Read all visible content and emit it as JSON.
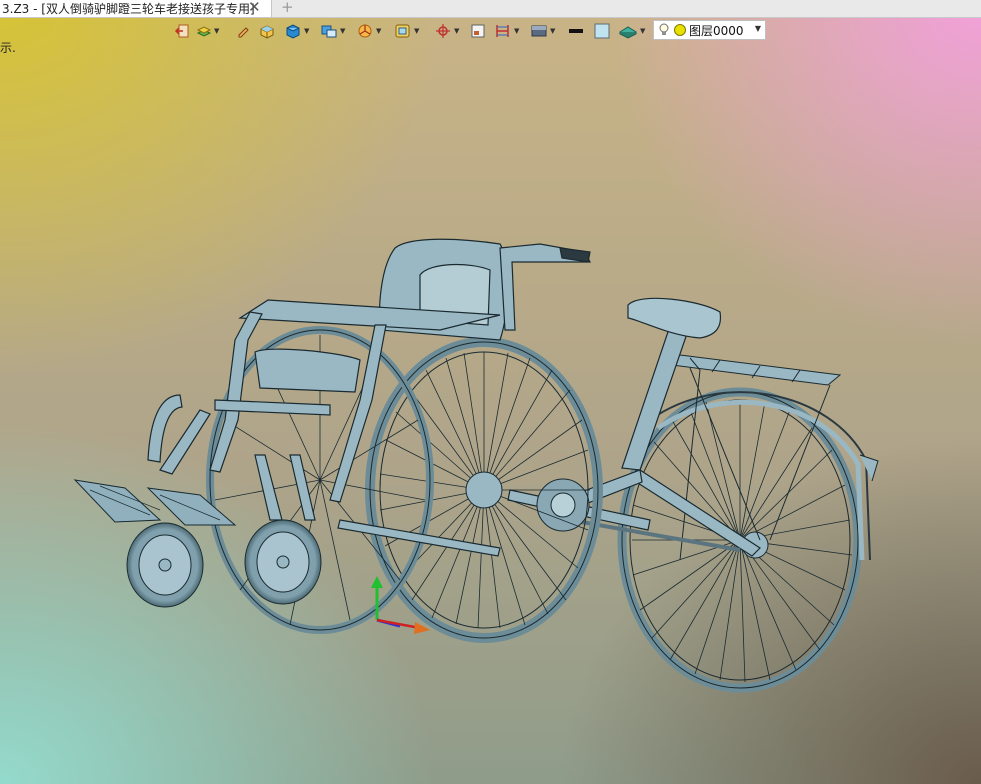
{
  "window": {
    "tab_title": "3.Z3 - [双人倒骑驴脚蹬三轮车老接送孩子专用]",
    "close_glyph": "✕",
    "new_tab_glyph": "+"
  },
  "status_snippet": "示.",
  "toolbar": {
    "icons": [
      "exit-sketch-icon",
      "layer-stack-icon",
      "pencil-icon",
      "solid-box-icon",
      "shaded-cube-icon",
      "render-mode-icon",
      "axis-gizmo-icon",
      "snap-target-icon",
      "frame-view-icon",
      "single-view-icon",
      "split-view-icon",
      "background-icon",
      "line-color-icon",
      "face-color-icon",
      "material-icon"
    ],
    "layer_bulb": "lightbulb-icon",
    "layer_dot_color": "#e8e000",
    "layer_name": "图层0000"
  },
  "scene": {
    "model": "tricycle with wheelchair front assembly",
    "model_color": "#9ab8c4",
    "line_color": "#1a2a30"
  }
}
